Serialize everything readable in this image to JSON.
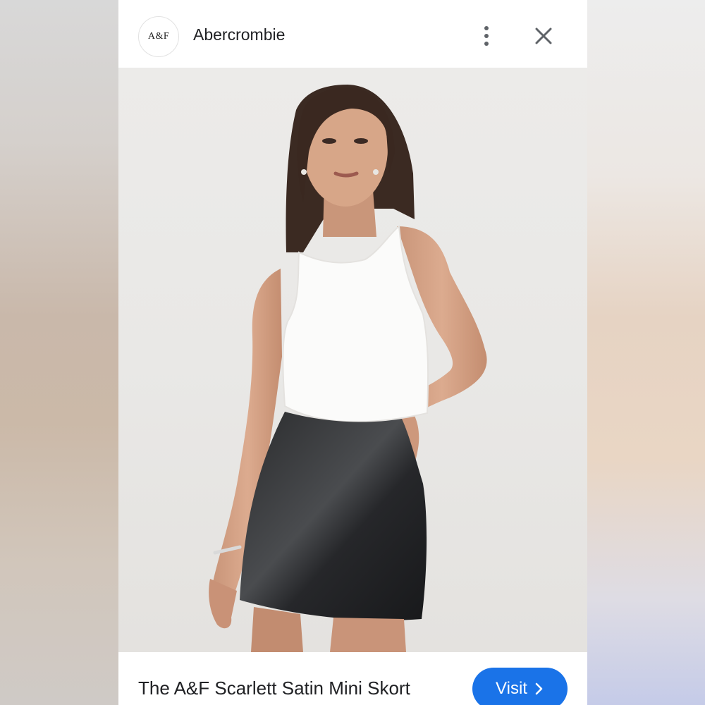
{
  "header": {
    "logo_text": "A&F",
    "brand": "Abercrombie",
    "more_icon": "more-vert-icon",
    "close_icon": "close-icon"
  },
  "image": {
    "description_icon": "product-photo",
    "lens_icon": "google-lens-icon"
  },
  "footer": {
    "title": "The A&F Scarlett Satin Mini Skort",
    "visit_label": "Visit",
    "visit_icon": "chevron-right-icon"
  },
  "colors": {
    "accent": "#1a73e8",
    "text": "#202124",
    "icon": "#5f6368"
  }
}
